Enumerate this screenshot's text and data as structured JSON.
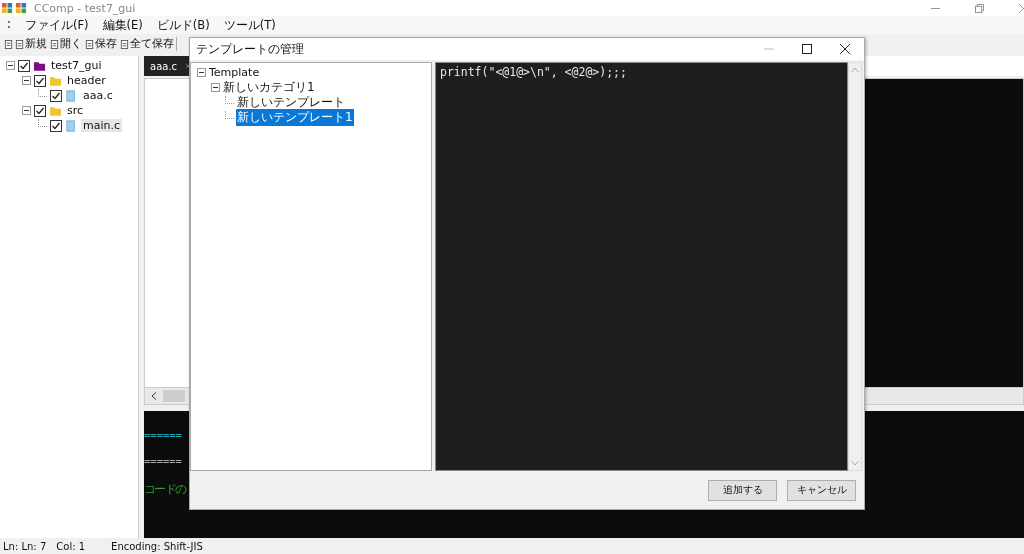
{
  "window": {
    "title": "CComp - test7_gui"
  },
  "menu": [
    "ファイル(F)",
    "編集(E)",
    "ビルド(B)",
    "ツール(T)"
  ],
  "toolbar": [
    "新規",
    "開く",
    "保存",
    "全て保存"
  ],
  "project_tree": [
    {
      "label": "test7_gui",
      "kind": "project",
      "checked": true,
      "selected": false,
      "expanded": true,
      "children": [
        {
          "label": "header",
          "kind": "folder",
          "checked": true,
          "selected": false,
          "expanded": true,
          "children": [
            {
              "label": "aaa.c",
              "kind": "file",
              "checked": true,
              "selected": false
            }
          ]
        },
        {
          "label": "src",
          "kind": "folder",
          "checked": true,
          "selected": false,
          "expanded": true,
          "children": [
            {
              "label": "main.c",
              "kind": "file",
              "checked": true,
              "selected": true
            }
          ]
        }
      ]
    }
  ],
  "editor": {
    "tabs": [
      {
        "label": "aaa.c",
        "selected": true
      }
    ]
  },
  "output": {
    "lines": [
      {
        "text": "======",
        "color": "#1fa8b4"
      },
      {
        "text": "======",
        "color": "#a8a8a8"
      },
      {
        "text": "コードの",
        "color": "#2e9e2e"
      }
    ]
  },
  "status_bar": {
    "position": "Ln: Ln: 7",
    "column": "Col: 1",
    "encoding": "Encoding: Shift-JIS"
  },
  "dialog": {
    "title": "テンプレートの管理",
    "tree": [
      {
        "label": "Template",
        "selected": false,
        "expanded": true,
        "children": [
          {
            "label": "新しいカテゴリ1",
            "selected": false,
            "expanded": true,
            "children": [
              {
                "label": "新しいテンプレート",
                "selected": false
              },
              {
                "label": "新しいテンプレート1",
                "selected": true
              }
            ]
          }
        ]
      }
    ],
    "code": "printf(\"<@1@>\\n\", <@2@>);;;",
    "buttons": [
      "追加する",
      "キャンセル"
    ]
  }
}
